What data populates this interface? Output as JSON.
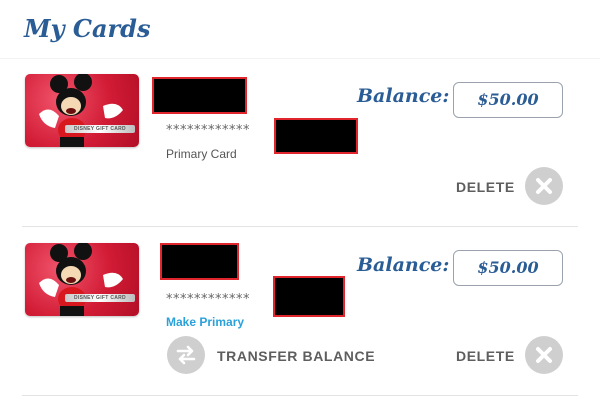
{
  "page": {
    "title": "My Cards"
  },
  "cards": [
    {
      "card_brand_text": "DISNEY GIFT CARD",
      "masked_number": "************",
      "status_label": "Primary Card",
      "balance_label": "Balance:",
      "balance_value": "$50.00",
      "delete_label": "DELETE",
      "icons": {
        "delete": "close-icon"
      }
    },
    {
      "card_brand_text": "DISNEY GIFT CARD",
      "masked_number": "************",
      "make_primary_label": "Make Primary",
      "balance_label": "Balance:",
      "balance_value": "$50.00",
      "transfer_label": "TRANSFER BALANCE",
      "delete_label": "DELETE",
      "icons": {
        "transfer": "transfer-arrows-icon",
        "delete": "close-icon"
      }
    }
  ],
  "colors": {
    "title_blue": "#2a5c95",
    "link_blue": "#2aa1d9",
    "card_red": "#d21b35",
    "redaction_border": "#e0262c",
    "button_gray": "#cfcfcf"
  }
}
